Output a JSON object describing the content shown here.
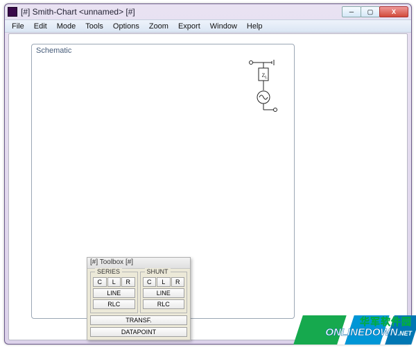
{
  "window": {
    "title": "[#] Smith-Chart <unnamed> [#]",
    "controls": {
      "min": "─",
      "max": "▢",
      "close": "X"
    }
  },
  "menubar": [
    "File",
    "Edit",
    "Mode",
    "Tools",
    "Options",
    "Zoom",
    "Export",
    "Window",
    "Help"
  ],
  "schematic": {
    "title": "Schematic",
    "components": [
      "load-impedance-ZL",
      "source"
    ]
  },
  "toolbox": {
    "title": "[#] Toolbox [#]",
    "series": {
      "legend": "SERIES",
      "clr": [
        "C",
        "L",
        "R"
      ],
      "line": "LINE",
      "rlc": "RLC"
    },
    "shunt": {
      "legend": "SHUNT",
      "clr": [
        "C",
        "L",
        "R"
      ],
      "line": "LINE",
      "rlc": "RLC"
    },
    "transf": "TRANSF.",
    "datapoint": "DATAPOINT"
  },
  "watermark": {
    "cn": "华军软件园",
    "en": "ONLINEDOWN",
    "net": ".NET"
  }
}
